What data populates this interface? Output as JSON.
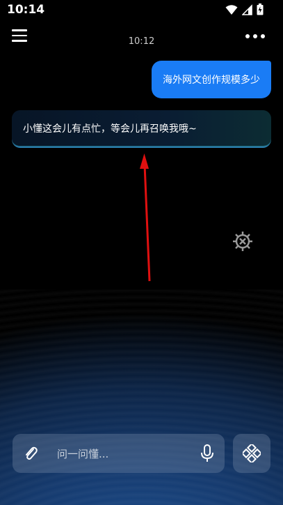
{
  "status_bar": {
    "time": "10:14"
  },
  "header": {
    "time": "10:12"
  },
  "chat": {
    "user_message": "海外网文创作规模多少",
    "bot_message": "小懂这会儿有点忙，等会儿再召唤我哦~"
  },
  "input": {
    "placeholder": "问一问懂..."
  },
  "colors": {
    "user_bubble": "#1a7cf5",
    "accent_arrow": "#e01010"
  }
}
